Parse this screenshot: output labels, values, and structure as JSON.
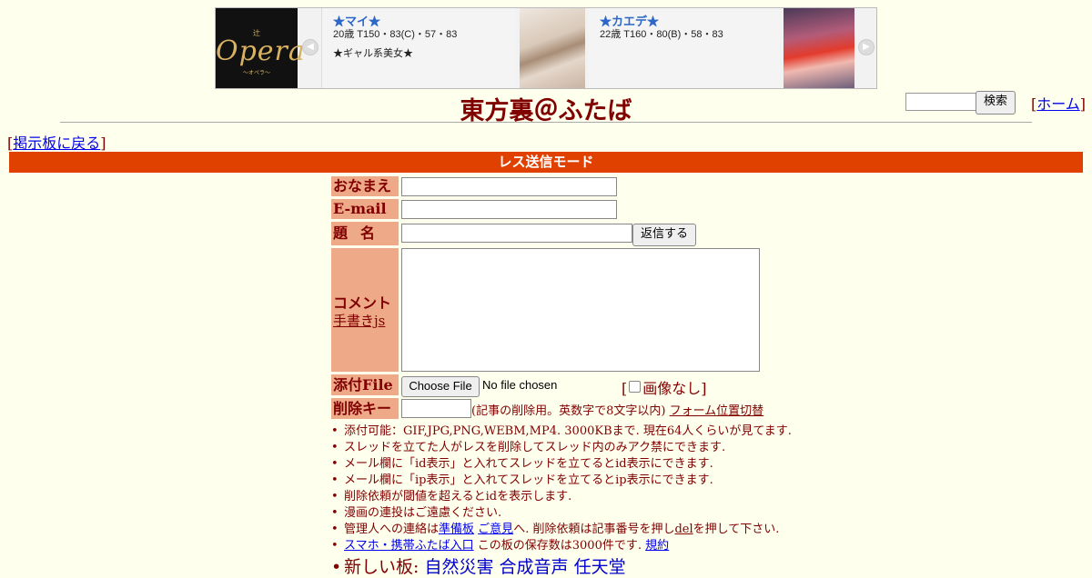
{
  "banner": {
    "logo": {
      "small": "辻",
      "text": "Opera",
      "sub": "〜オペラ〜"
    },
    "cards": [
      {
        "name": "★マイ★",
        "stats": "20歳 T150・83(C)・57・83",
        "desc": "★ギャル系美女★"
      },
      {
        "name": "★カエデ★",
        "stats": "22歳 T160・80(B)・58・83",
        "desc": ""
      }
    ]
  },
  "header": {
    "title": "東方裏＠ふたば",
    "search_button": "検索",
    "home_link": "ホーム",
    "back_link": "掲示板に戻る"
  },
  "mode_bar": "レス送信モード",
  "form": {
    "labels": {
      "name": "おなまえ",
      "email": "E-mail",
      "subject": "題名",
      "comment": "コメント",
      "handwriting": "手書きjs",
      "file": "添付File",
      "delkey": "削除キー"
    },
    "reply_button": "返信する",
    "choose_file_button": "Choose File",
    "file_status": "No file chosen",
    "noimage_label": "画像なし",
    "delkey_note": "(記事の削除用。英数字で8文字以内)",
    "form_position_link": "フォーム位置切替"
  },
  "notes": {
    "n1": "添付可能：GIF,JPG,PNG,WEBM,MP4. 3000KBまで. 現在64人くらいが見てます.",
    "n2": "スレッドを立てた人がレスを削除してスレッド内のみアク禁にできます.",
    "n3": "メール欄に「id表示」と入れてスレッドを立てるとid表示にできます.",
    "n4": "メール欄に「ip表示」と入れてスレッドを立てるとip表示にできます.",
    "n5": "削除依頼が閾値を超えるとidを表示します.",
    "n6": "漫画の連投はご遠慮ください.",
    "n7": {
      "pre": "管理人への連絡は",
      "link1": "準備板",
      "link2": "ご意見",
      "mid": "へ. 削除依頼は記事番号を押し",
      "link3": "del",
      "post": "を押して下さい."
    },
    "n8": {
      "link1": "スマホ・携帯ふたば入口",
      "mid": "この板の保存数は3000件です.",
      "link2": "規約"
    },
    "n9": {
      "pre": "新しい板:",
      "boards": [
        "自然災害",
        "合成音声",
        "任天堂"
      ]
    }
  },
  "colors": {
    "background": "#ffffee",
    "text": "#800000",
    "mode_bar": "#e04000",
    "label_bg": "#eeaa88",
    "link": "#0000ee"
  }
}
